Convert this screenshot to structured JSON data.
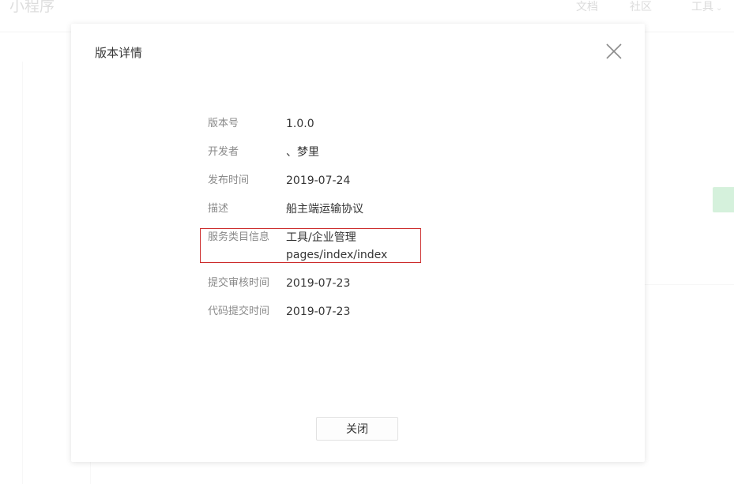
{
  "header": {
    "app_title": "小程序",
    "nav": {
      "docs": "文档",
      "community": "社区",
      "tools": "工具"
    }
  },
  "modal": {
    "title": "版本详情",
    "fields": {
      "version": {
        "label": "版本号",
        "value": "1.0.0"
      },
      "developer": {
        "label": "开发者",
        "value": "、梦里"
      },
      "release_time": {
        "label": "发布时间",
        "value": "2019-07-24"
      },
      "description": {
        "label": "描述",
        "value": "船主端运输协议"
      },
      "service_category": {
        "label": "服务类目信息",
        "value_line1": "工具/企业管理",
        "value_line2": "pages/index/index"
      },
      "submit_review_time": {
        "label": "提交审核时间",
        "value": "2019-07-23"
      },
      "code_submit_time": {
        "label": "代码提交时间",
        "value": "2019-07-23"
      }
    },
    "close_button_label": "关闭",
    "highlight_color": "#cc2b2b"
  },
  "icons": {
    "close": "close-icon",
    "tools_dropdown": "chevron-down-icon"
  }
}
